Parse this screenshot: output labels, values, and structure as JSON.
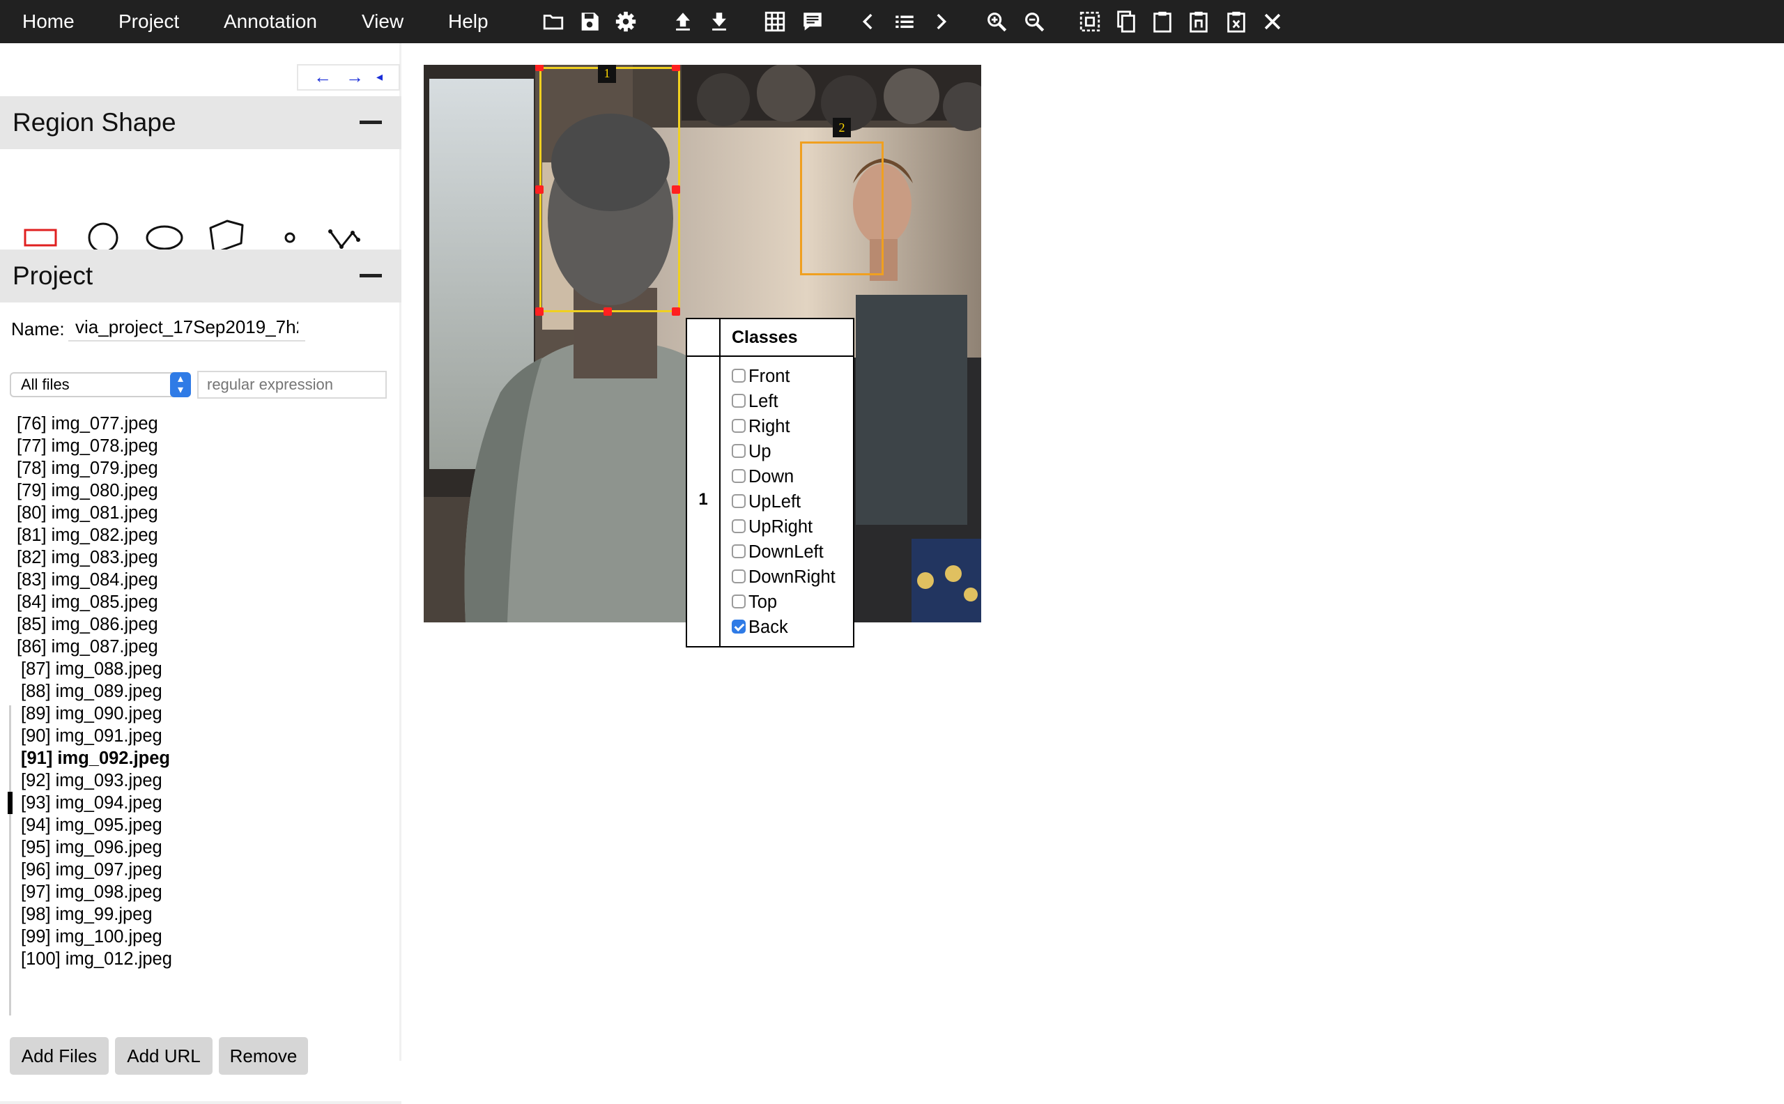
{
  "menu": [
    "Home",
    "Project",
    "Annotation",
    "View",
    "Help"
  ],
  "toolbar_icons": [
    "folder-open-icon",
    "save-icon",
    "settings-icon",
    "upload-icon",
    "download-icon",
    "grid-view-icon",
    "comment-icon",
    "chevron-left-icon",
    "list-icon",
    "chevron-right-icon",
    "zoom-in-icon",
    "zoom-out-icon",
    "select-all-icon",
    "copy-icon",
    "paste-icon",
    "paste-n-icon",
    "delete-region-icon",
    "close-icon"
  ],
  "panel_arrows": [
    "←",
    "→",
    "◂"
  ],
  "region_shape": {
    "title": "Region Shape",
    "shapes": [
      "rectangle-shape-icon",
      "circle-shape-icon",
      "ellipse-shape-icon",
      "polygon-shape-icon",
      "point-shape-icon",
      "polyline-shape-icon"
    ],
    "active_color": "#e02020"
  },
  "project": {
    "title": "Project",
    "name_label": "Name:",
    "name_value": "via_project_17Sep2019_7h2",
    "filter_selected": "All files",
    "regex_placeholder": "regular expression",
    "files": [
      "[76] img_077.jpeg",
      "[77] img_078.jpeg",
      "[78] img_079.jpeg",
      "[79] img_080.jpeg",
      "[80] img_081.jpeg",
      "[81] img_082.jpeg",
      "[82] img_083.jpeg",
      "[83] img_084.jpeg",
      "[84] img_085.jpeg",
      "[85] img_086.jpeg",
      "[86] img_087.jpeg",
      "[87] img_088.jpeg",
      "[88] img_089.jpeg",
      "[89] img_090.jpeg",
      "[90] img_091.jpeg",
      "[91] img_092.jpeg",
      "[92] img_093.jpeg",
      "[93] img_094.jpeg",
      "[94] img_095.jpeg",
      "[95] img_096.jpeg",
      "[96] img_097.jpeg",
      "[97] img_098.jpeg",
      "[98] img_99.jpeg",
      "[99] img_100.jpeg",
      "[100] img_012.jpeg"
    ],
    "active_file": "[91] img_092.jpeg",
    "buttons": {
      "add_files": "Add Files",
      "add_url": "Add URL",
      "remove": "Remove"
    }
  },
  "regions": [
    {
      "id": "1",
      "color": "#f0d020",
      "selected": true
    },
    {
      "id": "2",
      "color": "#f0a020",
      "selected": false
    }
  ],
  "attribute_popup": {
    "header": "Classes",
    "region_id": "1",
    "options": [
      {
        "label": "Front",
        "checked": false
      },
      {
        "label": "Left",
        "checked": false
      },
      {
        "label": "Right",
        "checked": false
      },
      {
        "label": "Up",
        "checked": false
      },
      {
        "label": "Down",
        "checked": false
      },
      {
        "label": "UpLeft",
        "checked": false
      },
      {
        "label": "UpRight",
        "checked": false
      },
      {
        "label": "DownLeft",
        "checked": false
      },
      {
        "label": "DownRight",
        "checked": false
      },
      {
        "label": "Top",
        "checked": false
      },
      {
        "label": "Back",
        "checked": true
      }
    ]
  }
}
